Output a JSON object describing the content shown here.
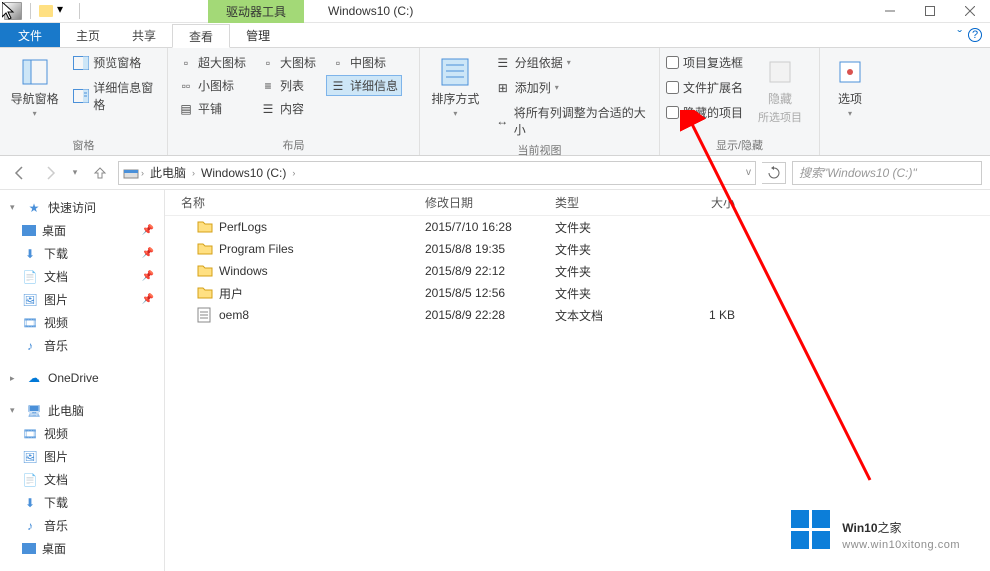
{
  "titlebar": {
    "context_tab": "驱动器工具",
    "title": "Windows10 (C:)"
  },
  "tabs": {
    "file": "文件",
    "home": "主页",
    "share": "共享",
    "view": "查看",
    "manage": "管理"
  },
  "ribbon": {
    "panes": {
      "nav_pane": "导航窗格",
      "preview_pane": "预览窗格",
      "details_pane": "详细信息窗格",
      "label": "窗格"
    },
    "layout": {
      "extra_large": "超大图标",
      "large": "大图标",
      "medium": "中图标",
      "small": "小图标",
      "list": "列表",
      "details": "详细信息",
      "tiles": "平铺",
      "content": "内容",
      "label": "布局"
    },
    "current_view": {
      "sort_by": "排序方式",
      "group_by": "分组依据",
      "add_columns": "添加列",
      "size_all": "将所有列调整为合适的大小",
      "label": "当前视图"
    },
    "show_hide": {
      "item_checkboxes": "项目复选框",
      "file_ext": "文件扩展名",
      "hidden_items": "隐藏的项目",
      "hide": "隐藏",
      "hide_sub": "所选项目",
      "label": "显示/隐藏"
    },
    "options": {
      "label": "选项"
    }
  },
  "address": {
    "this_pc": "此电脑",
    "drive": "Windows10 (C:)"
  },
  "search": {
    "placeholder": "搜索\"Windows10 (C:)\""
  },
  "sidebar": {
    "quick_access": "快速访问",
    "desktop": "桌面",
    "downloads": "下载",
    "documents": "文档",
    "pictures": "图片",
    "videos": "视频",
    "music": "音乐",
    "onedrive": "OneDrive",
    "this_pc": "此电脑",
    "pc_videos": "视频",
    "pc_pictures": "图片",
    "pc_documents": "文档",
    "pc_downloads": "下载",
    "pc_music": "音乐",
    "pc_desktop": "桌面"
  },
  "columns": {
    "name": "名称",
    "date": "修改日期",
    "type": "类型",
    "size": "大小"
  },
  "files": [
    {
      "name": "PerfLogs",
      "date": "2015/7/10 16:28",
      "type": "文件夹",
      "size": "",
      "icon": "folder"
    },
    {
      "name": "Program Files",
      "date": "2015/8/8 19:35",
      "type": "文件夹",
      "size": "",
      "icon": "folder"
    },
    {
      "name": "Windows",
      "date": "2015/8/9 22:12",
      "type": "文件夹",
      "size": "",
      "icon": "folder"
    },
    {
      "name": "用户",
      "date": "2015/8/5 12:56",
      "type": "文件夹",
      "size": "",
      "icon": "folder"
    },
    {
      "name": "oem8",
      "date": "2015/8/9 22:28",
      "type": "文本文档",
      "size": "1 KB",
      "icon": "text"
    }
  ],
  "watermark": {
    "line1a": "Win10",
    "line1b": "之家",
    "line2": "www.win10xitong.com"
  }
}
